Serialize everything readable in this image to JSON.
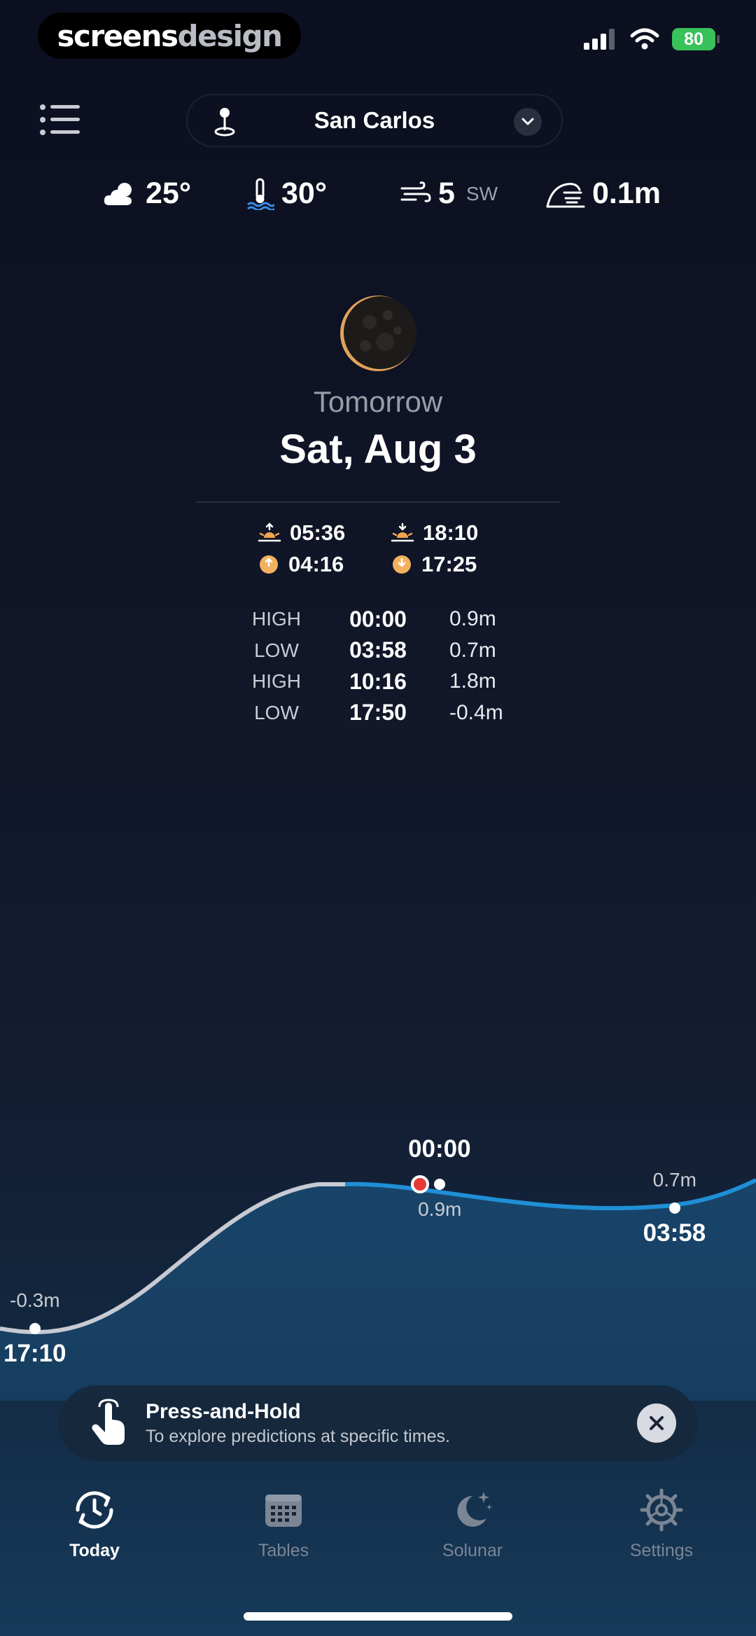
{
  "status_bar": {
    "brand_part1": "screens",
    "brand_part2": "design",
    "battery": "80"
  },
  "header": {
    "location": "San Carlos"
  },
  "weather": {
    "air_temp": "25°",
    "water_temp": "30°",
    "wind_speed": "5",
    "wind_dir": "SW",
    "wave_height": "0.1m"
  },
  "day": {
    "relative": "Tomorrow",
    "date": "Sat, Aug 3"
  },
  "sun_moon": {
    "sunrise": "05:36",
    "sunset": "18:10",
    "moonrise": "04:16",
    "moonset": "17:25"
  },
  "tides": [
    {
      "type": "HIGH",
      "time": "00:00",
      "height": "0.9m"
    },
    {
      "type": "LOW",
      "time": "03:58",
      "height": "0.7m"
    },
    {
      "type": "HIGH",
      "time": "10:16",
      "height": "1.8m"
    },
    {
      "type": "LOW",
      "time": "17:50",
      "height": "-0.4m"
    }
  ],
  "chart_data": {
    "type": "area",
    "title": "",
    "points": [
      {
        "time": "17:10",
        "height": -0.3,
        "height_label": "-0.3m"
      },
      {
        "time": "00:00",
        "height": 0.9,
        "height_label": "0.9m"
      },
      {
        "time": "03:58",
        "height": 0.7,
        "height_label": "0.7m"
      }
    ],
    "colors": {
      "past": "#c7cad3",
      "future": "#1f8fd6",
      "current": "#e53935"
    }
  },
  "hint": {
    "title": "Press-and-Hold",
    "subtitle": "To explore predictions at specific times."
  },
  "tabs": [
    {
      "label": "Today",
      "icon": "clock-arrows-icon",
      "active": true
    },
    {
      "label": "Tables",
      "icon": "calendar-grid-icon",
      "active": false
    },
    {
      "label": "Solunar",
      "icon": "moon-stars-icon",
      "active": false
    },
    {
      "label": "Settings",
      "icon": "gear-icon",
      "active": false
    }
  ]
}
